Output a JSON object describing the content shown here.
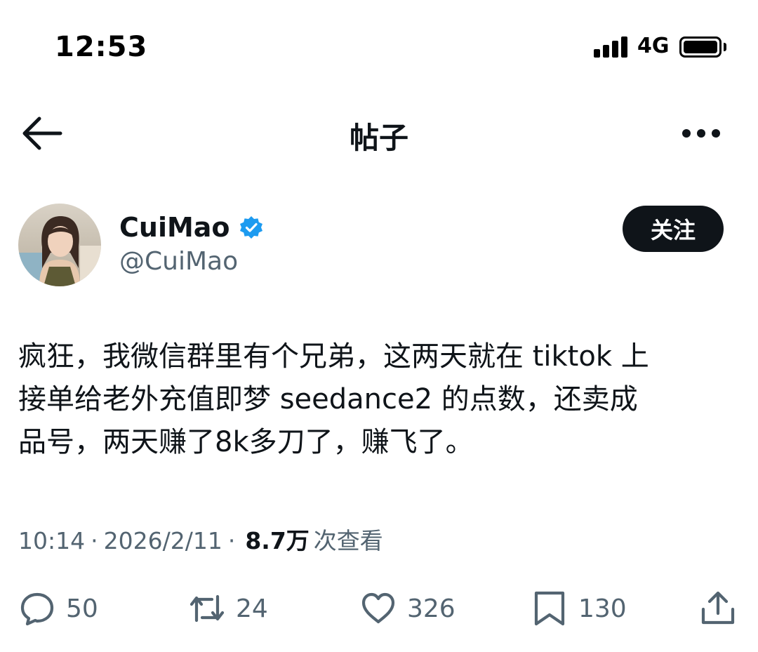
{
  "status_bar": {
    "time": "12:53",
    "network": "4G"
  },
  "header": {
    "title": "帖子",
    "back_icon": "arrow-left-icon",
    "more_icon": "more-horizontal-icon"
  },
  "author": {
    "name": "CuiMao",
    "handle": "@CuiMao",
    "verified": true,
    "verified_color": "#1d9bf0",
    "follow_label": "关注"
  },
  "tweet": {
    "lines": [
      "疯狂，我微信群里有个兄弟，这两天就在 tiktok 上",
      "接单给老外充值即梦 seedance2 的点数，还卖成",
      "品号，两天赚了8k多刀了，赚飞了。"
    ]
  },
  "meta": {
    "time": "10:14",
    "sep": "·",
    "date": "2026/2/11",
    "views_count": "8.7万",
    "views_label": "次查看"
  },
  "actions": {
    "replies": "50",
    "reposts": "24",
    "likes": "326",
    "bookmarks": "130"
  }
}
